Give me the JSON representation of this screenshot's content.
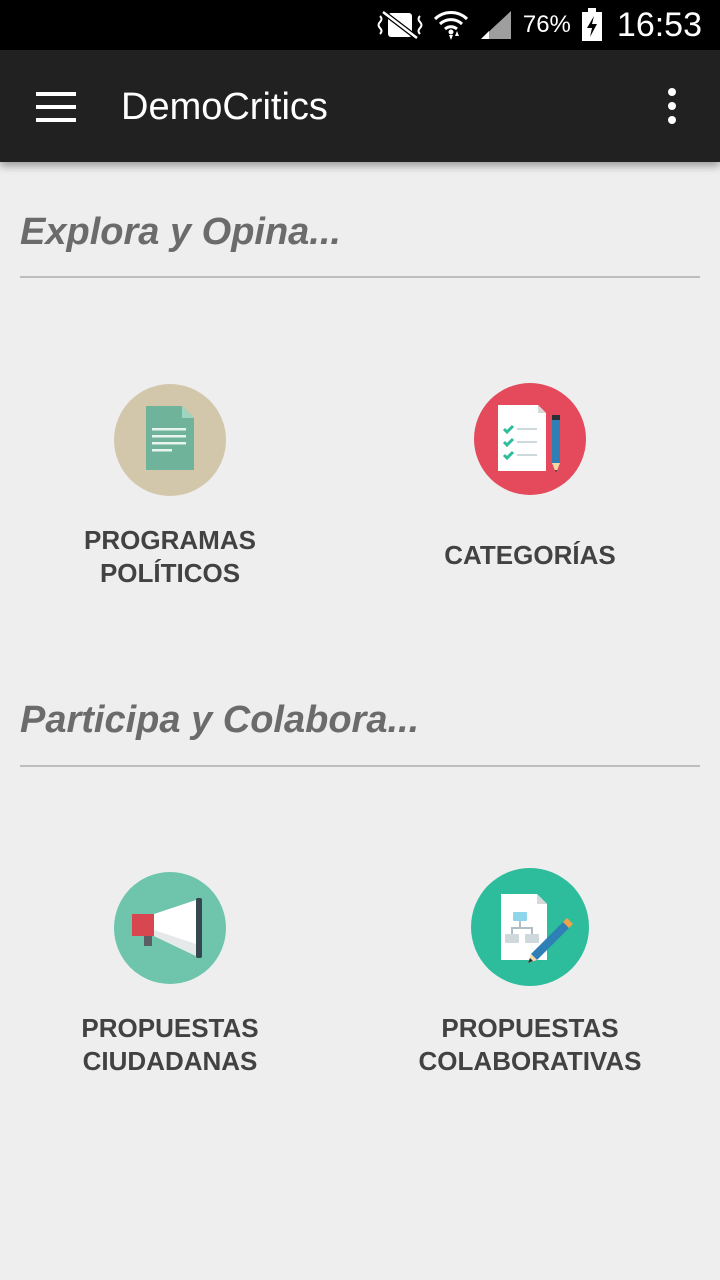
{
  "status_bar": {
    "battery": "76%",
    "time": "16:53",
    "icons": [
      "mute-vibrate-icon",
      "wifi-icon",
      "signal-icon",
      "battery-charging-icon"
    ]
  },
  "app_bar": {
    "title": "DemoCritics",
    "background": "#212121",
    "icons": [
      "menu-icon",
      "overflow-menu-icon"
    ]
  },
  "sections": [
    {
      "title": "Explora y Opina...",
      "tiles": [
        {
          "label": "PROGRAMAS\nPOLÍTICOS",
          "icon": "document-icon",
          "circle_color": "#d3c7ab"
        },
        {
          "label": "CATEGORÍAS",
          "icon": "checklist-icon",
          "circle_color": "#e4495c"
        }
      ]
    },
    {
      "title": "Participa y Colabora...",
      "tiles": [
        {
          "label": "PROPUESTAS\nCIUDADANAS",
          "icon": "megaphone-icon",
          "circle_color": "#6ec5ac"
        },
        {
          "label": "PROPUESTAS\nCOLABORATIVAS",
          "icon": "diagram-edit-icon",
          "circle_color": "#2ebd9c"
        }
      ]
    }
  ]
}
